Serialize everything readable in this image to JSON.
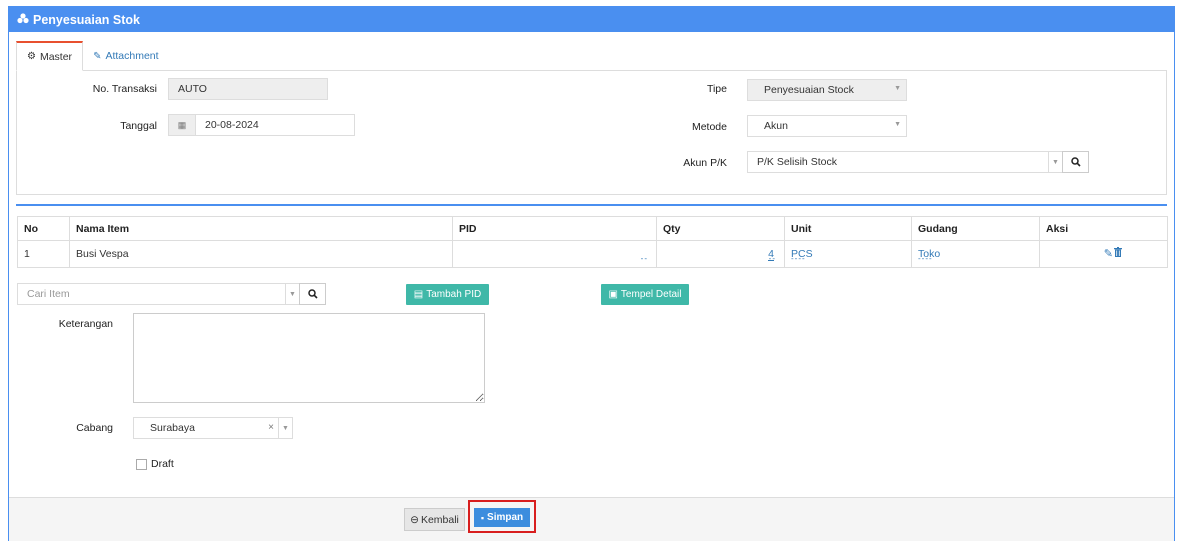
{
  "panel": {
    "title": "Penyesuaian Stok",
    "icon": "cubes-icon"
  },
  "tabs": [
    {
      "label": "Master",
      "icon": "gears-icon",
      "active": true
    },
    {
      "label": "Attachment",
      "icon": "paperclip-icon",
      "active": false
    }
  ],
  "master": {
    "no_transaksi_label": "No. Transaksi",
    "no_transaksi_value": "AUTO",
    "tanggal_label": "Tanggal",
    "tanggal_value": "20-08-2024",
    "tipe_label": "Tipe",
    "tipe_value": "Penyesuaian Stock",
    "metode_label": "Metode",
    "metode_value": "Akun",
    "akun_label": "Akun P/K",
    "akun_value": "P/K Selisih Stock"
  },
  "table": {
    "headers": [
      "No",
      "Nama Item",
      "PID",
      "Qty",
      "Unit",
      "Gudang",
      "Aksi"
    ],
    "rows": [
      {
        "no": "1",
        "nama": "Busi Vespa",
        "pid": "--",
        "qty": "4",
        "qty_sub": "--",
        "unit": "PCS",
        "unit_sub": "----",
        "gudang": "Toko",
        "gudang_sub": "----"
      }
    ]
  },
  "search": {
    "placeholder": "Cari Item"
  },
  "buttons": {
    "tambah_pid": "Tambah PID",
    "tempel_detail": "Tempel Detail",
    "kembali": "Kembali",
    "simpan": "Simpan"
  },
  "form": {
    "keterangan_label": "Keterangan",
    "keterangan_value": "",
    "cabang_label": "Cabang",
    "cabang_value": "Surabaya",
    "draft_label": "Draft",
    "draft_checked": false
  },
  "colors": {
    "primary": "#4a8ff0",
    "teal": "#3fb8a8",
    "highlight": "#d81e1e",
    "tab_accent": "#e8502f"
  }
}
